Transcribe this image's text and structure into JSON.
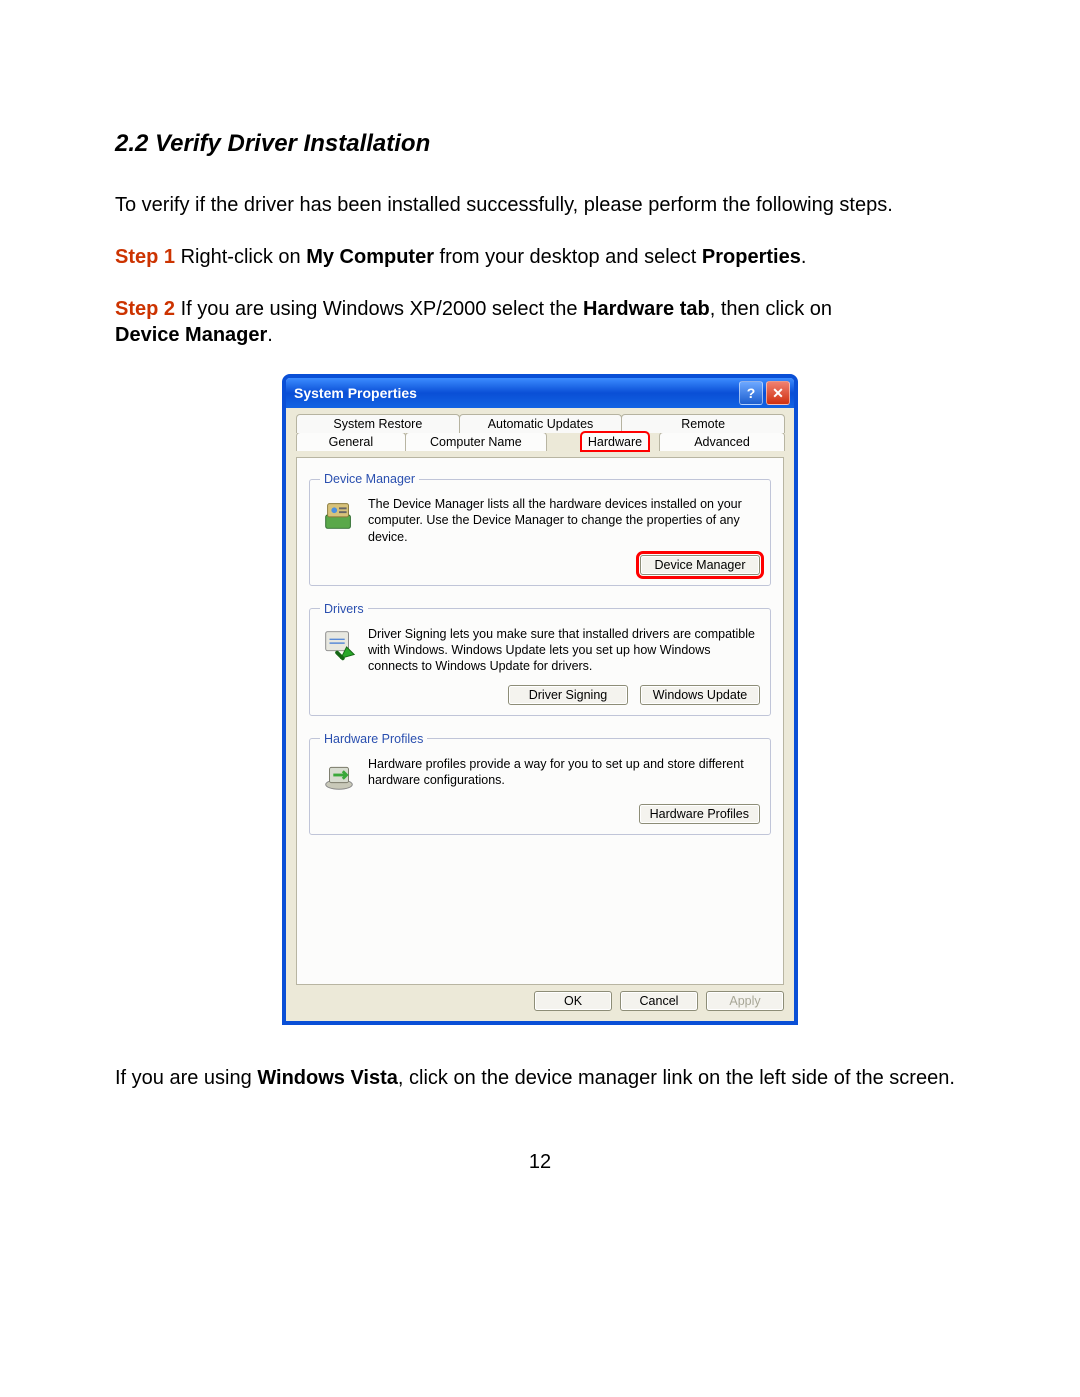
{
  "doc": {
    "section_heading": "2.2 Verify Driver Installation",
    "intro": "To verify if the driver has been installed successfully, please perform the following steps.",
    "step1_label": "Step 1",
    "step1_a": " Right-click on ",
    "step1_b_bold": "My Computer",
    "step1_c": " from your desktop and select ",
    "step1_d_bold": "Properties",
    "step1_e": ".",
    "step2_label": "Step 2",
    "step2_a": " If you are using Windows XP/2000 select the ",
    "step2_b_bold": "Hardware tab",
    "step2_c": ", then click on ",
    "step2_d_bold": "Device Manager",
    "step2_e": ".",
    "vista_a": "If you are using ",
    "vista_b_bold": "Windows Vista",
    "vista_c": ", click on the device manager link on the left side of the screen.",
    "page_number": "12"
  },
  "dialog": {
    "title": "System Properties",
    "tabs_row1": {
      "t1": "System Restore",
      "t2": "Automatic Updates",
      "t3": "Remote"
    },
    "tabs_row2": {
      "t1": "General",
      "t2": "Computer Name",
      "t3_active": "Hardware",
      "t4": "Advanced"
    },
    "group_dm": {
      "legend": "Device Manager",
      "text": "The Device Manager lists all the hardware devices installed on your computer. Use the Device Manager to change the properties of any device.",
      "button": "Device Manager"
    },
    "group_drv": {
      "legend": "Drivers",
      "text": "Driver Signing lets you make sure that installed drivers are compatible with Windows. Windows Update lets you set up how Windows connects to Windows Update for drivers.",
      "btn1": "Driver Signing",
      "btn2": "Windows Update"
    },
    "group_hp": {
      "legend": "Hardware Profiles",
      "text": "Hardware profiles provide a way for you to set up and store different hardware configurations.",
      "button": "Hardware Profiles"
    },
    "footer": {
      "ok": "OK",
      "cancel": "Cancel",
      "apply": "Apply"
    }
  }
}
